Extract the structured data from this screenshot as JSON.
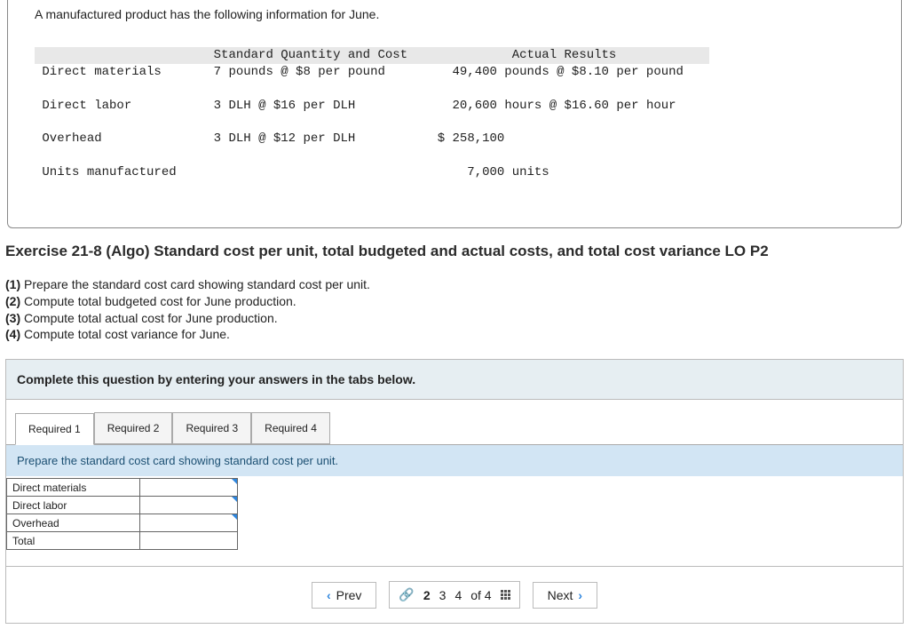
{
  "info": {
    "intro": "A manufactured product has the following information for June.",
    "header_std": "Standard Quantity and Cost",
    "header_act": "Actual Results",
    "rows": {
      "dm_label": "Direct materials",
      "dm_std": "7 pounds @ $8 per pound",
      "dm_act": "49,400 pounds @ $8.10 per pound",
      "dl_label": "Direct labor",
      "dl_std": "3 DLH @ $16 per DLH",
      "dl_act": "20,600 hours @ $16.60 per hour",
      "oh_label": "Overhead",
      "oh_std": "3 DLH @ $12 per DLH",
      "oh_act": "$ 258,100",
      "units_label": "Units manufactured",
      "units_act": "7,000 units"
    }
  },
  "exercise_title": "Exercise 21-8 (Algo) Standard cost per unit, total budgeted and actual costs, and total cost variance LO P2",
  "tasks": {
    "t1n": "(1)",
    "t1": "Prepare the standard cost card showing standard cost per unit.",
    "t2n": "(2)",
    "t2": "Compute total budgeted cost for June production.",
    "t3n": "(3)",
    "t3": "Compute total actual cost for June production.",
    "t4n": "(4)",
    "t4": "Compute total cost variance for June."
  },
  "panel": {
    "instruction": "Complete this question by entering your answers in the tabs below.",
    "tabs": {
      "r1": "Required 1",
      "r2": "Required 2",
      "r3": "Required 3",
      "r4": "Required 4"
    },
    "tab_desc": "Prepare the standard cost card showing standard cost per unit.",
    "grid_labels": {
      "dm": "Direct materials",
      "dl": "Direct labor",
      "oh": "Overhead",
      "total": "Total"
    }
  },
  "pager": {
    "prev": "Prev",
    "next": "Next",
    "p2": "2",
    "p3": "3",
    "p4": "4",
    "of": "of 4"
  }
}
